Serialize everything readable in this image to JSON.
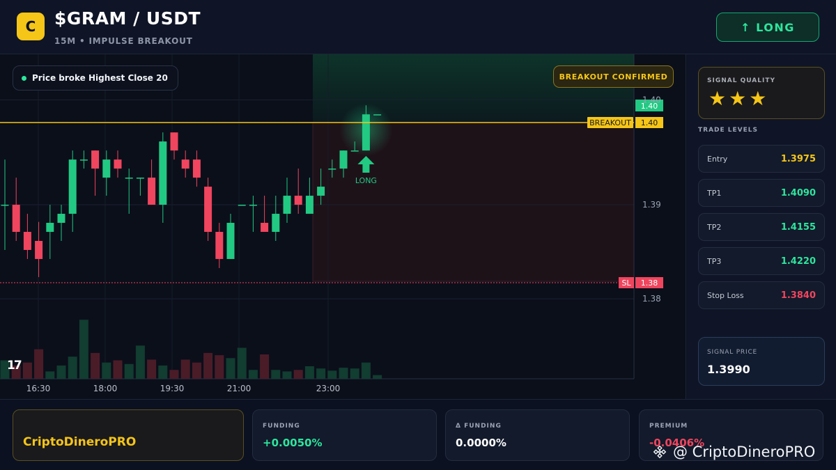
{
  "header": {
    "logo_letter": "C",
    "title": "$GRAM / USDT",
    "subtitle": "15M • IMPULSE BREAKOUT",
    "direction_button": "↑ LONG"
  },
  "chart": {
    "pill_text": "Price broke Highest Close 20",
    "breakout_badge": "BREAKOUT CONFIRMED",
    "breakout_label": "BREAKOUT",
    "breakout_value": "1.40",
    "sl_label": "SL",
    "sl_value": "1.38",
    "current_price_tag": "1.40",
    "signal_marker_label": "LONG",
    "tv_logo": "17",
    "colors": {
      "up": "#22c983",
      "down": "#f0455e",
      "breakout": "#f5c518"
    }
  },
  "chart_data": {
    "type": "candlestick",
    "y_ticks": [
      "1.40",
      "1.39",
      "1.38"
    ],
    "x_ticks": [
      "16:30",
      "18:00",
      "19:30",
      "21:00",
      "23:00"
    ],
    "ylim": [
      1.3748,
      1.4053
    ],
    "breakout_level": 1.3975,
    "stop_loss_level": 1.384,
    "candles": [
      {
        "o": 1.3902,
        "h": 1.3952,
        "l": 1.3852,
        "c": 1.3902
      },
      {
        "o": 1.3902,
        "h": 1.3932,
        "l": 1.3862,
        "c": 1.3872
      },
      {
        "o": 1.3872,
        "h": 1.3892,
        "l": 1.3842,
        "c": 1.3852
      },
      {
        "o": 1.3862,
        "h": 1.3883,
        "l": 1.3822,
        "c": 1.3842
      },
      {
        "o": 1.3872,
        "h": 1.3902,
        "l": 1.3842,
        "c": 1.3882
      },
      {
        "o": 1.3882,
        "h": 1.3902,
        "l": 1.3862,
        "c": 1.3892
      },
      {
        "o": 1.3892,
        "h": 1.3962,
        "l": 1.3872,
        "c": 1.3952
      },
      {
        "o": 1.3952,
        "h": 1.3962,
        "l": 1.3942,
        "c": 1.3952
      },
      {
        "o": 1.3962,
        "h": 1.3962,
        "l": 1.3912,
        "c": 1.3942
      },
      {
        "o": 1.3932,
        "h": 1.3962,
        "l": 1.3912,
        "c": 1.3952
      },
      {
        "o": 1.3952,
        "h": 1.3962,
        "l": 1.3932,
        "c": 1.3942
      },
      {
        "o": 1.3932,
        "h": 1.3942,
        "l": 1.3892,
        "c": 1.3932
      },
      {
        "o": 1.3932,
        "h": 1.3932,
        "l": 1.3912,
        "c": 1.3932
      },
      {
        "o": 1.3932,
        "h": 1.3952,
        "l": 1.3902,
        "c": 1.3902
      },
      {
        "o": 1.3902,
        "h": 1.3982,
        "l": 1.3882,
        "c": 1.3972
      },
      {
        "o": 1.3982,
        "h": 1.3982,
        "l": 1.3952,
        "c": 1.3962
      },
      {
        "o": 1.3952,
        "h": 1.3962,
        "l": 1.3932,
        "c": 1.3942
      },
      {
        "o": 1.3952,
        "h": 1.3962,
        "l": 1.3922,
        "c": 1.3932
      },
      {
        "o": 1.3922,
        "h": 1.3932,
        "l": 1.3862,
        "c": 1.3872
      },
      {
        "o": 1.3872,
        "h": 1.3882,
        "l": 1.3832,
        "c": 1.3842
      },
      {
        "o": 1.3842,
        "h": 1.3892,
        "l": 1.3842,
        "c": 1.3882
      },
      {
        "o": 1.3902,
        "h": 1.3902,
        "l": 1.3902,
        "c": 1.3902
      },
      {
        "o": 1.3902,
        "h": 1.3912,
        "l": 1.3872,
        "c": 1.3902
      },
      {
        "o": 1.3882,
        "h": 1.3912,
        "l": 1.3872,
        "c": 1.3872
      },
      {
        "o": 1.3872,
        "h": 1.3912,
        "l": 1.3862,
        "c": 1.3892
      },
      {
        "o": 1.3892,
        "h": 1.3932,
        "l": 1.3882,
        "c": 1.3912
      },
      {
        "o": 1.3912,
        "h": 1.3942,
        "l": 1.3892,
        "c": 1.3902
      },
      {
        "o": 1.3892,
        "h": 1.3932,
        "l": 1.3892,
        "c": 1.3912
      },
      {
        "o": 1.3912,
        "h": 1.3942,
        "l": 1.3902,
        "c": 1.3922
      },
      {
        "o": 1.3942,
        "h": 1.3952,
        "l": 1.3932,
        "c": 1.3942
      },
      {
        "o": 1.3942,
        "h": 1.3962,
        "l": 1.3932,
        "c": 1.3962
      },
      {
        "o": 1.3962,
        "h": 1.3972,
        "l": 1.3962,
        "c": 1.3962
      },
      {
        "o": 1.3962,
        "h": 1.4012,
        "l": 1.3962,
        "c": 1.4002
      },
      {
        "o": 1.4002,
        "h": 1.4002,
        "l": 1.4002,
        "c": 1.4002
      }
    ],
    "volumes": [
      25,
      18,
      22,
      40,
      10,
      18,
      30,
      80,
      35,
      22,
      25,
      20,
      45,
      26,
      18,
      12,
      26,
      22,
      35,
      32,
      28,
      42,
      12,
      33,
      12,
      10,
      12,
      17,
      14,
      11,
      15,
      14,
      22,
      5
    ]
  },
  "sidebar": {
    "signal_quality_label": "SIGNAL QUALITY",
    "stars": "★★★",
    "trade_levels_label": "TRADE LEVELS",
    "levels": [
      {
        "label": "Entry",
        "value": "1.3975",
        "color": "#f5c518"
      },
      {
        "label": "TP1",
        "value": "1.4090",
        "color": "#2ee59d"
      },
      {
        "label": "TP2",
        "value": "1.4155",
        "color": "#2ee59d"
      },
      {
        "label": "TP3",
        "value": "1.4220",
        "color": "#2ee59d"
      },
      {
        "label": "Stop Loss",
        "value": "1.3840",
        "color": "#f0455e"
      }
    ],
    "signal_price_label": "SIGNAL PRICE",
    "signal_price_value": "1.3990"
  },
  "footer": {
    "brand": "CriptoDineroPRO",
    "stats": [
      {
        "label": "FUNDING",
        "value": "+0.0050%",
        "color": "#2ee59d"
      },
      {
        "label": "Δ FUNDING",
        "value": "0.0000%",
        "color": "#ffffff"
      },
      {
        "label": "PREMIUM",
        "value": "-0.0406%",
        "color": "#f0455e"
      }
    ],
    "watermark": "@ CriptoDineroPRO"
  }
}
